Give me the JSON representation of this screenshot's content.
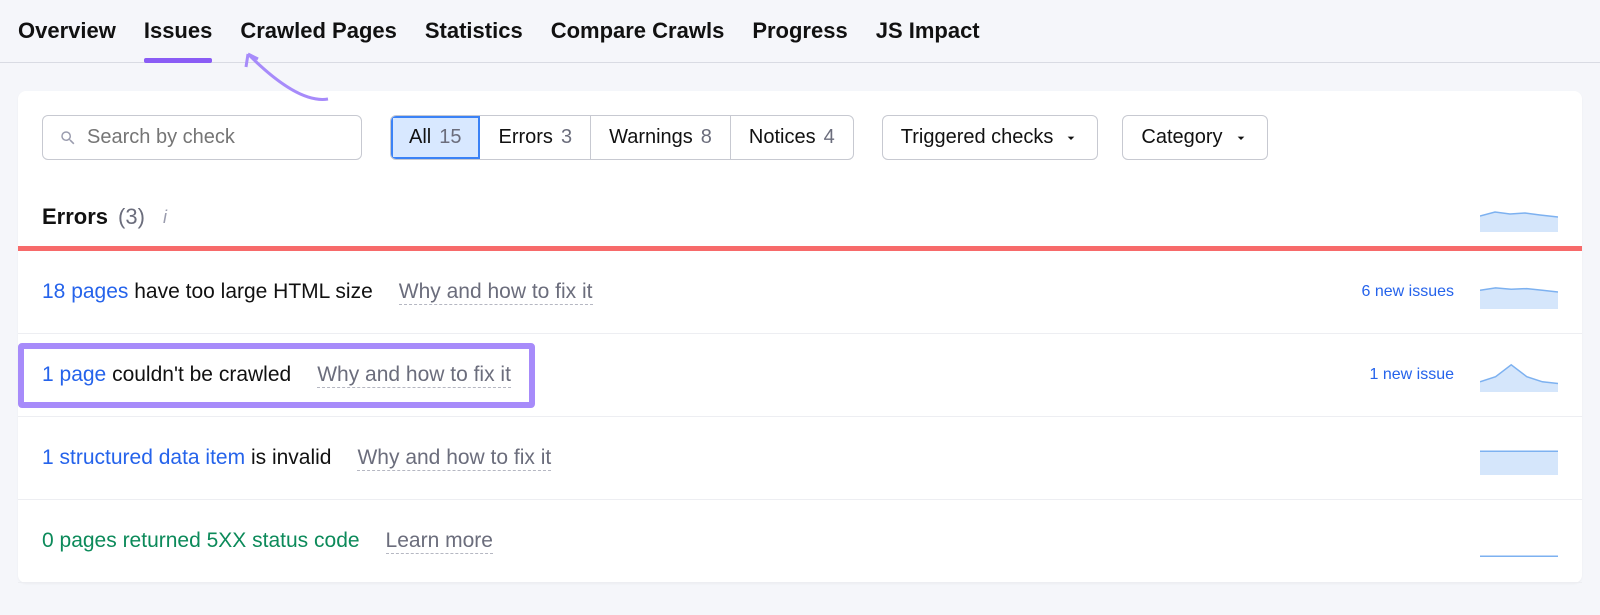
{
  "tabs": [
    {
      "label": "Overview",
      "active": false
    },
    {
      "label": "Issues",
      "active": true
    },
    {
      "label": "Crawled Pages",
      "active": false
    },
    {
      "label": "Statistics",
      "active": false
    },
    {
      "label": "Compare Crawls",
      "active": false
    },
    {
      "label": "Progress",
      "active": false
    },
    {
      "label": "JS Impact",
      "active": false
    }
  ],
  "search": {
    "placeholder": "Search by check"
  },
  "filters": [
    {
      "label": "All",
      "count": "15",
      "selected": true
    },
    {
      "label": "Errors",
      "count": "3",
      "selected": false
    },
    {
      "label": "Warnings",
      "count": "8",
      "selected": false
    },
    {
      "label": "Notices",
      "count": "4",
      "selected": false
    }
  ],
  "dropdowns": [
    {
      "label": "Triggered checks"
    },
    {
      "label": "Category"
    }
  ],
  "section": {
    "title": "Errors",
    "count": "(3)"
  },
  "issues": [
    {
      "link_text": "18 pages",
      "rest": " have too large HTML size",
      "why": "Why and how to fix it",
      "new_text": "6 new issues",
      "highlight": false,
      "zero": false,
      "spark": [
        0.45,
        0.38,
        0.42,
        0.4,
        0.45,
        0.5
      ],
      "fill": true
    },
    {
      "link_text": "1 page",
      "rest": " couldn't be crawled",
      "why": "Why and how to fix it",
      "new_text": "1 new issue",
      "highlight": true,
      "zero": false,
      "spark": [
        0.7,
        0.55,
        0.2,
        0.55,
        0.7,
        0.75
      ],
      "fill": true
    },
    {
      "link_text": "1 structured data item",
      "rest": " is invalid",
      "why": "Why and how to fix it",
      "new_text": "",
      "highlight": false,
      "zero": false,
      "spark": [
        0.3,
        0.3,
        0.3,
        0.3,
        0.3,
        0.3
      ],
      "fill": true
    },
    {
      "link_text": "0 pages",
      "rest": " returned 5XX status code",
      "why": "Learn more",
      "new_text": "",
      "highlight": false,
      "zero": true,
      "spark": [
        0.95,
        0.95,
        0.95,
        0.95,
        0.95,
        0.95
      ],
      "fill": false
    }
  ]
}
